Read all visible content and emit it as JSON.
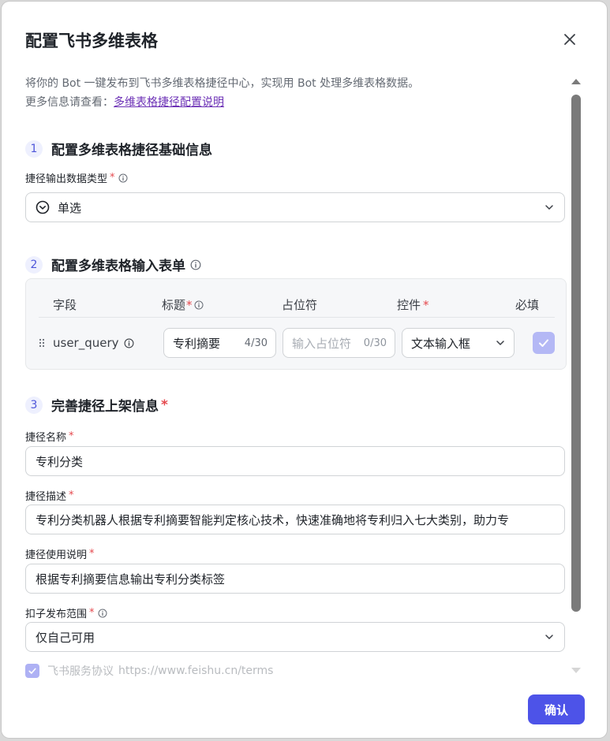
{
  "dialog": {
    "title": "配置飞书多维表格",
    "description_line1": "将你的 Bot 一键发布到飞书多维表格捷径中心，实现用 Bot 处理多维表格数据。",
    "description_line2_prefix": "更多信息请查看：",
    "description_link": "多维表格捷径配置说明"
  },
  "section1": {
    "step": "1",
    "title": "配置多维表格捷径基础信息",
    "output_type_label": "捷径输出数据类型",
    "output_type_value": "单选"
  },
  "section2": {
    "step": "2",
    "title": "配置多维表格输入表单",
    "columns": {
      "field": "字段",
      "title": "标题",
      "placeholder": "占位符",
      "control": "控件",
      "required": "必填"
    },
    "row": {
      "field_name": "user_query",
      "title_value": "专利摘要",
      "title_count": "4/30",
      "placeholder_hint": "输入占位符",
      "placeholder_count": "0/30",
      "control_value": "文本输入框",
      "required_checked": true
    }
  },
  "section3": {
    "step": "3",
    "title": "完善捷径上架信息",
    "name_label": "捷径名称",
    "name_value": "专利分类",
    "desc_label": "捷径描述",
    "desc_value": "专利分类机器人根据专利摘要智能判定核心技术，快速准确地将专利归入七大类别，助力专",
    "usage_label": "捷径使用说明",
    "usage_value": "根据专利摘要信息输出专利分类标签",
    "scope_label": "扣子发布范围",
    "scope_value": "仅自己可用",
    "terms_label": "飞书服务协议",
    "terms_url": "https://www.feishu.cn/terms",
    "terms_checked": true
  },
  "required_mark": "*",
  "footer": {
    "confirm_label": "确认"
  },
  "colors": {
    "accent": "#4d53e8",
    "link": "#6b2fb5",
    "required": "#e5484d"
  }
}
